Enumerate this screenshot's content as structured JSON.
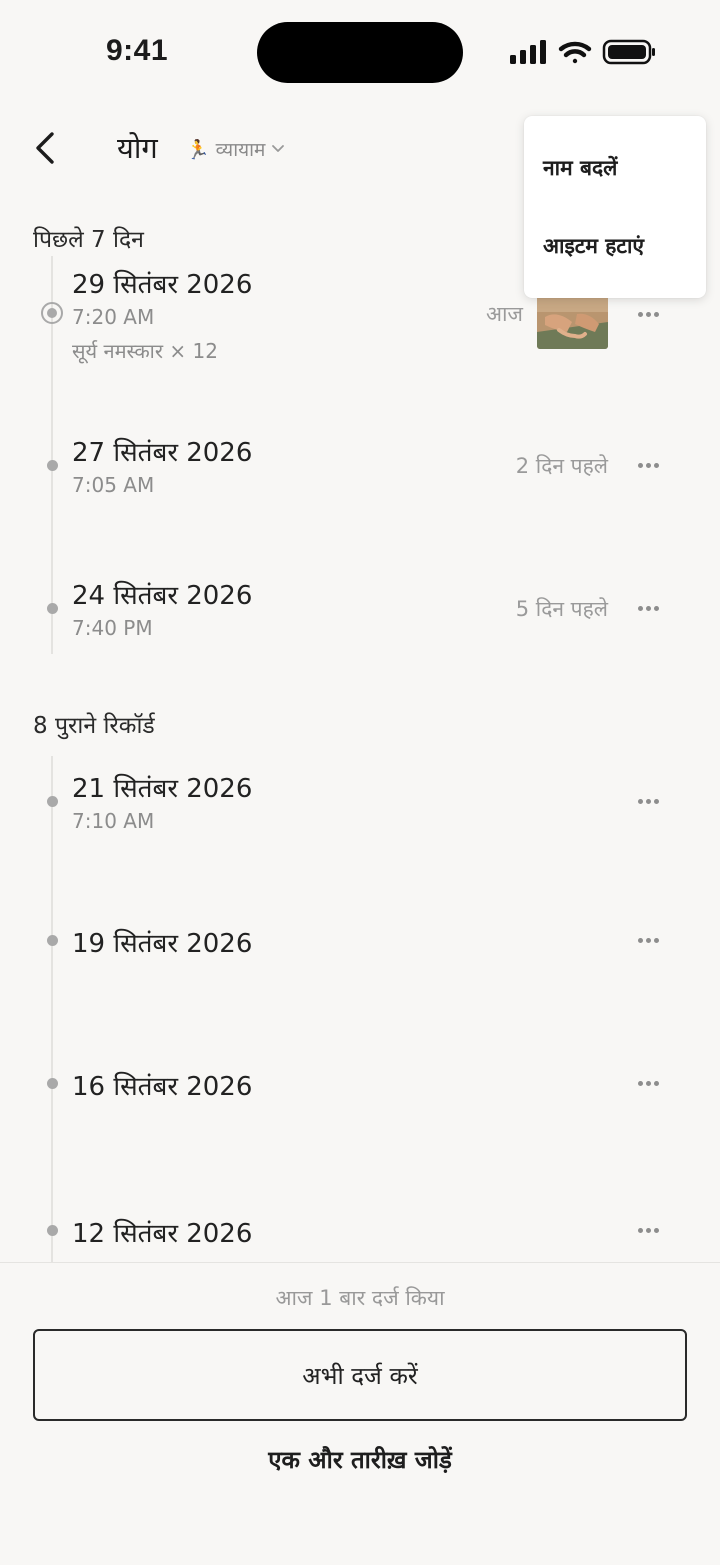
{
  "status_bar": {
    "time": "9:41"
  },
  "header": {
    "title": "योग",
    "category_emoji": "🏃",
    "category_label": "व्यायाम"
  },
  "menu": {
    "rename": "नाम बदलें",
    "delete": "आइटम हटाएं"
  },
  "recent": {
    "heading": "पिछले 7 दिन",
    "entries": [
      {
        "date": "29 सितंबर 2026",
        "time": "7:20 AM",
        "note": "सूर्य नमस्कार × 12",
        "relative": "आज"
      },
      {
        "date": "27 सितंबर 2026",
        "time": "7:05 AM",
        "relative": "2 दिन पहले"
      },
      {
        "date": "24 सितंबर 2026",
        "time": "7:40 PM",
        "relative": "5 दिन पहले"
      }
    ]
  },
  "older": {
    "heading": "8 पुराने रिकॉर्ड",
    "entries": [
      {
        "date": "21 सितंबर 2026",
        "time": "7:10 AM"
      },
      {
        "date": "19 सितंबर 2026"
      },
      {
        "date": "16 सितंबर 2026"
      },
      {
        "date": "12 सितंबर 2026"
      }
    ]
  },
  "footer": {
    "logged_today": "आज 1 बार दर्ज किया",
    "log_now": "अभी दर्ज करें",
    "add_date": "एक और तारीख़ जोड़ें"
  },
  "colors": {
    "background": "#f8f7f5",
    "muted_text": "#8c8c8c",
    "timeline_dot": "#a9a9a9"
  }
}
